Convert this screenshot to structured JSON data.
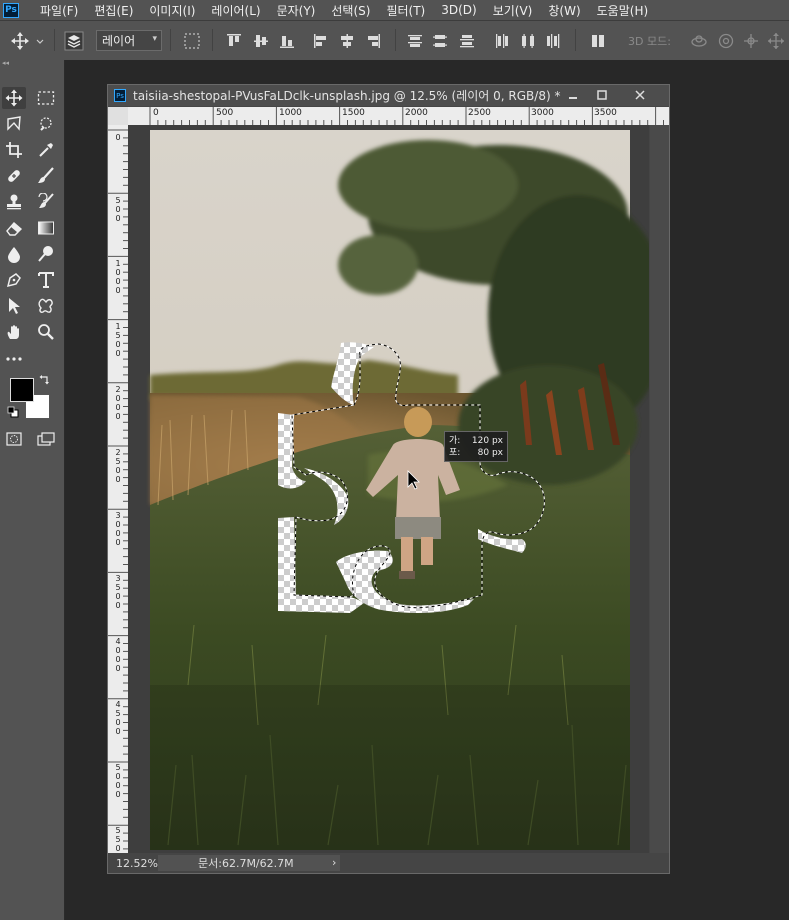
{
  "app": {
    "logo": "Ps"
  },
  "menu": [
    "파일(F)",
    "편집(E)",
    "이미지(I)",
    "레이어(L)",
    "문자(Y)",
    "선택(S)",
    "필터(T)",
    "3D(D)",
    "보기(V)",
    "창(W)",
    "도움말(H)"
  ],
  "options_bar": {
    "layer_select_value": "레이어",
    "mode_3d_label": "3D 모드:"
  },
  "tools": [
    "move-icon",
    "marquee-icon",
    "lasso-icon",
    "quick-select-icon",
    "crop-icon",
    "eyedropper-icon",
    "healing-icon",
    "brush-icon",
    "stamp-icon",
    "history-brush-icon",
    "eraser-icon",
    "gradient-icon",
    "blur-icon",
    "dodge-icon",
    "pen-icon",
    "type-icon",
    "path-select-icon",
    "shape-icon",
    "hand-icon",
    "zoom-icon",
    "more-icon"
  ],
  "colors": {
    "foreground": "#000000",
    "background": "#ffffff",
    "accent": "#31a8ff",
    "ui_panel": "#535353",
    "workspace": "#282828"
  },
  "document": {
    "title": "taisiia-shestopal-PVusFaLDclk-unsplash.jpg @ 12.5% (레이어 0, RGB/8) *",
    "ruler_h": [
      "0",
      "500",
      "1000",
      "1500",
      "2000",
      "2500",
      "3000",
      "3500"
    ],
    "ruler_v": [
      "0",
      "500",
      "1000",
      "1500",
      "2000",
      "2500",
      "3000",
      "3500",
      "4000",
      "4500",
      "5000",
      "5500"
    ],
    "zoom": "12.52%",
    "doc_info": "문서:62.7M/62.7M"
  },
  "tooltip": {
    "width_label": "가:",
    "width_value": "120 px",
    "height_label": "포:",
    "height_value": "80 px"
  }
}
